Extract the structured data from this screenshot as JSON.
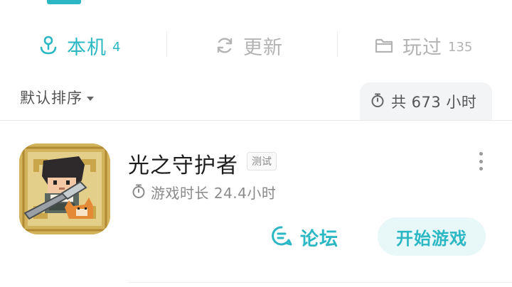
{
  "colors": {
    "accent": "#2bb8c4",
    "muted": "#b3b3b3",
    "badge_bg": "#e8f7f8"
  },
  "tabs": [
    {
      "label": "本机",
      "count": "4",
      "icon": "device-anchor-icon",
      "active": true
    },
    {
      "label": "更新",
      "count": "",
      "icon": "refresh-icon",
      "active": false
    },
    {
      "label": "玩过",
      "count": "135",
      "icon": "folder-icon",
      "active": false
    }
  ],
  "sort": {
    "label": "默认排序"
  },
  "total_time": {
    "label": "共 673 小时"
  },
  "game": {
    "title": "光之守护者",
    "badge": "测试",
    "playtime": "游戏时长 24.4小时",
    "forum_label": "论坛",
    "play_label": "开始游戏"
  }
}
